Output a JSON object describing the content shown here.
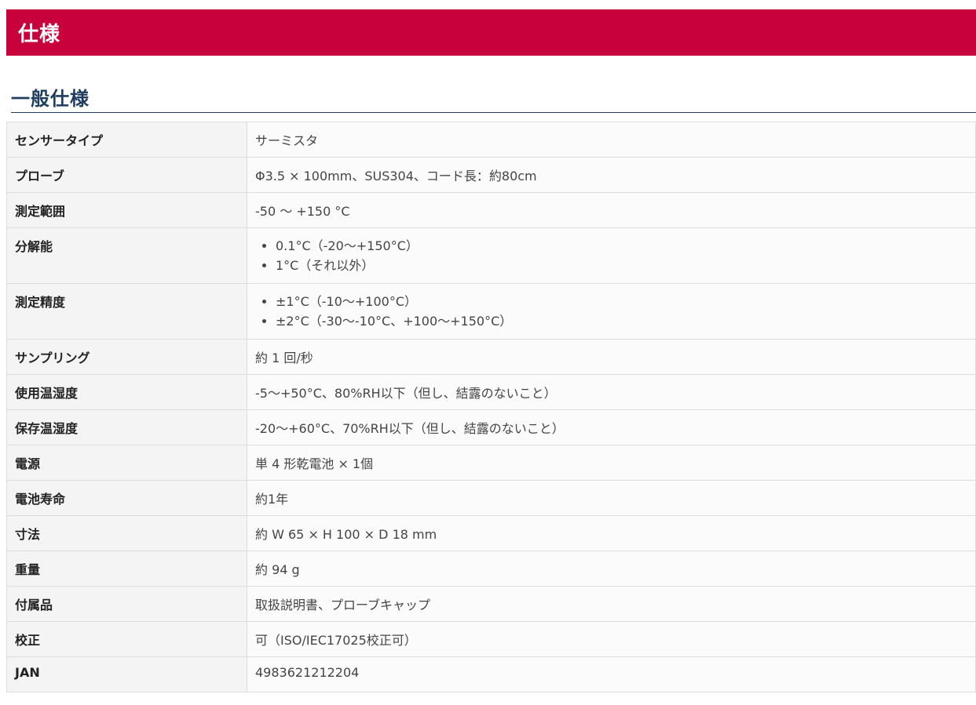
{
  "banner": {
    "title": "仕様"
  },
  "section": {
    "title": "一般仕様"
  },
  "spec": {
    "rows": [
      {
        "label": "センサータイプ",
        "value": "サーミスタ"
      },
      {
        "label": "プローブ",
        "value": "Φ3.5 × 100mm、SUS304、コード長：約80cm"
      },
      {
        "label": "測定範囲",
        "value": "-50 〜 +150 °C"
      },
      {
        "label": "分解能",
        "items": [
          "0.1°C（-20〜+150°C）",
          "1°C（それ以外）"
        ]
      },
      {
        "label": "測定精度",
        "items": [
          "±1°C（-10〜+100°C）",
          "±2°C（-30〜-10°C、+100〜+150°C）"
        ]
      },
      {
        "label": "サンプリング",
        "value": "約 1 回/秒"
      },
      {
        "label": "使用温湿度",
        "value": "-5〜+50°C、80%RH以下（但し、結露のないこと）"
      },
      {
        "label": "保存温湿度",
        "value": "-20〜+60°C、70%RH以下（但し、結露のないこと）"
      },
      {
        "label": "電源",
        "value": "単 4 形乾電池 × 1個"
      },
      {
        "label": "電池寿命",
        "value": "約1年"
      },
      {
        "label": "寸法",
        "value": "約 W 65 × H 100 × D 18 mm"
      },
      {
        "label": "重量",
        "value": "約 94 g"
      },
      {
        "label": "付属品",
        "value": "取扱説明書、プローブキャップ"
      },
      {
        "label": "校正",
        "value": "可（ISO/IEC17025校正可）"
      },
      {
        "label": "JAN",
        "value": "4983621212204"
      }
    ]
  }
}
